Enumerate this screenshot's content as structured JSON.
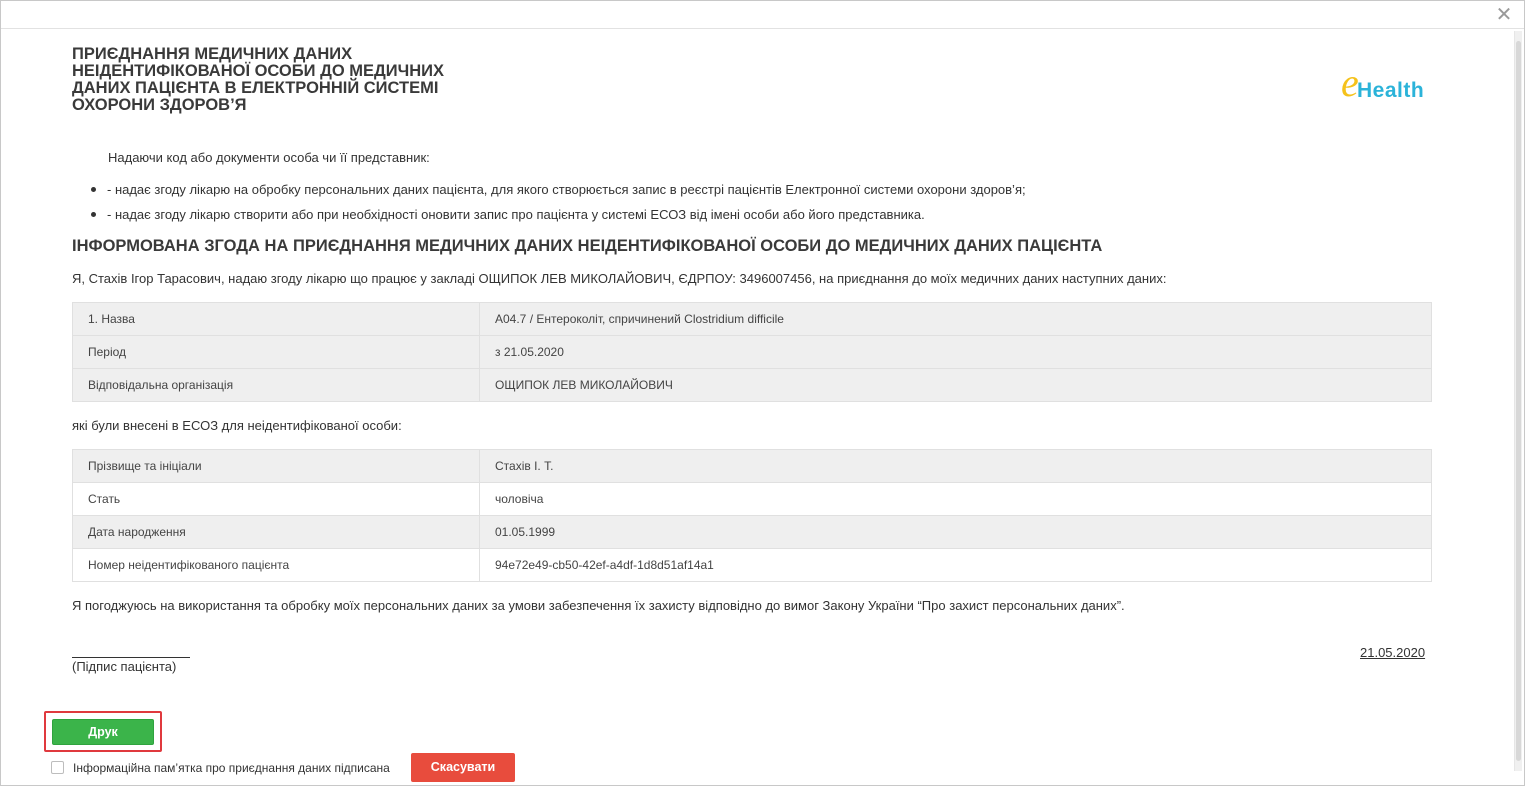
{
  "dialog": {
    "close_glyph": "✕",
    "title": "ПРИЄДНАННЯ МЕДИЧНИХ ДАНИХ НЕІДЕНТИФІКОВАНОЇ ОСОБИ ДО МЕДИЧНИХ ДАНИХ ПАЦІЄНТА В ЕЛЕКТРОННІЙ СИСТЕМІ ОХОРОНИ ЗДОРОВ’Я",
    "logo": {
      "e": "e",
      "text": "Health",
      "colors": {
        "e": "#f5c21b",
        "health": "#2bb3d9"
      }
    }
  },
  "document": {
    "intro": "Надаючи код або документи особа чи її представник:",
    "bullets": [
      "- надає згоду лікарю на обробку персональних даних пацієнта, для якого створюється запис в реєстрі пацієнтів Електронної системи охорони здоров’я;",
      "- надає згоду лікарю створити або при необхідності оновити запис про пацієнта у системі ЕСОЗ від імені особи або його представника."
    ],
    "heading": "ІНФОРМОВАНА ЗГОДА НА ПРИЄДНАННЯ МЕДИЧНИХ ДАНИХ НЕІДЕНТИФІКОВАНОЇ ОСОБИ ДО МЕДИЧНИХ ДАНИХ ПАЦІЄНТА",
    "consent": "Я, Стахів Ігор Тарасович, надаю згоду лікарю що працює у закладі ОЩИПОК ЛЕВ МИКОЛАЙОВИЧ, ЄДРПОУ: 3496007456, на приєднання до моїх медичних даних наступних даних:",
    "table1": [
      {
        "key": "1. Назва",
        "value": "A04.7 / Ентероколіт, спричинений Clostridium difficile"
      },
      {
        "key": "Період",
        "value": "з 21.05.2020"
      },
      {
        "key": "Відповідальна організація",
        "value": "ОЩИПОК ЛЕВ МИКОЛАЙОВИЧ"
      }
    ],
    "between": "які були внесені в ЕСОЗ для неідентифікованої особи:",
    "table2": [
      {
        "key": "Прізвище та ініціали",
        "value": "Стахів І. Т."
      },
      {
        "key": "Стать",
        "value": "чоловіча"
      },
      {
        "key": "Дата народження",
        "value": "01.05.1999"
      },
      {
        "key": "Номер неідентифікованого пацієнта",
        "value": "94e72e49-cb50-42ef-a4df-1d8d51af14a1"
      }
    ],
    "agree": "Я погоджуюсь на використання та обробку моїх персональних даних за умови забезпечення їх захисту відповідно до вимог Закону України “Про захист персональних даних”.",
    "signature_label": "(Підпис пацієнта)",
    "date": "21.05.2020"
  },
  "actions": {
    "print_label": "Друк",
    "checkbox_label": "Інформаційна пам’ятка про приєднання даних підписана",
    "checkbox_checked": false,
    "cancel_label": "Скасувати",
    "colors": {
      "print": "#3bb44a",
      "cancel": "#e84c3d",
      "highlight": "#e0393e"
    }
  }
}
